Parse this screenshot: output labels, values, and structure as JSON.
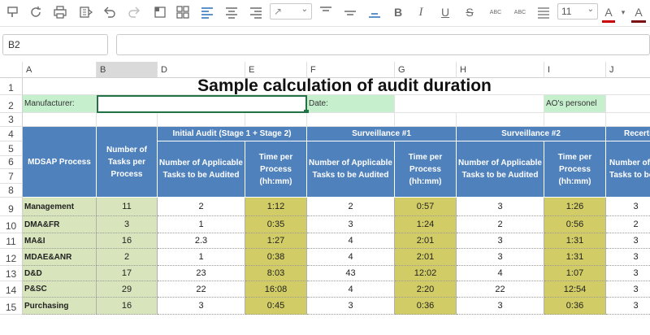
{
  "toolbar": {
    "font_size": "11",
    "font_size_arrow": "⌄",
    "rotate_arrow": "⌄",
    "bold": "B",
    "italic": "I",
    "underline": "U",
    "strike": "S",
    "abc1": "ABC",
    "abc2": "ABC",
    "font_color_letter": "A",
    "highlight_letter": "A",
    "color_arrow": "▾",
    "text_color": "#cc0000"
  },
  "name_box": "B2",
  "columns": [
    "A",
    "B",
    "D",
    "E",
    "F",
    "G",
    "H",
    "I",
    "J"
  ],
  "selected_column": "B",
  "rows": [
    "1",
    "2",
    "3",
    "4",
    "5",
    "6",
    "7",
    "8",
    "9",
    "10",
    "11",
    "12",
    "13",
    "14",
    "15"
  ],
  "sheet": {
    "title": "Sample calculation of audit duration",
    "manufacturer_label": "Manufacturer:",
    "date_label": "Date:",
    "ao_label": "AO's personel",
    "headers": {
      "process": "MDSAP Process",
      "tasks_per_process": "Number of Tasks per Process",
      "initial_audit": "Initial Audit (Stage 1 + Stage 2)",
      "surveillance1": "Surveillance #1",
      "surveillance2": "Surveillance #2",
      "recertification": "Recerti",
      "applicable": "Number of Applicable Tasks to be Audited",
      "time": "Time per Process (hh:mm)",
      "applicable_cut": "Number of A Tasks to be"
    },
    "data_rows": [
      {
        "process": "Management",
        "tasks": "11",
        "ia_n": "2",
        "ia_t": "1:12",
        "s1_n": "2",
        "s1_t": "0:57",
        "s2_n": "3",
        "s2_t": "1:26",
        "rc_n": "3"
      },
      {
        "process": "DMA&FR",
        "tasks": "3",
        "ia_n": "1",
        "ia_t": "0:35",
        "s1_n": "3",
        "s1_t": "1:24",
        "s2_n": "2",
        "s2_t": "0:56",
        "rc_n": "2"
      },
      {
        "process": "MA&I",
        "tasks": "16",
        "ia_n": "2.3",
        "ia_t": "1:27",
        "s1_n": "4",
        "s1_t": "2:01",
        "s2_n": "3",
        "s2_t": "1:31",
        "rc_n": "3"
      },
      {
        "process": "MDAE&ANR",
        "tasks": "2",
        "ia_n": "1",
        "ia_t": "0:38",
        "s1_n": "4",
        "s1_t": "2:01",
        "s2_n": "3",
        "s2_t": "1:31",
        "rc_n": "3"
      },
      {
        "process": "D&D",
        "tasks": "17",
        "ia_n": "23",
        "ia_t": "8:03",
        "s1_n": "43",
        "s1_t": "12:02",
        "s2_n": "4",
        "s2_t": "1:07",
        "rc_n": "3"
      },
      {
        "process": "P&SC",
        "tasks": "29",
        "ia_n": "22",
        "ia_t": "16:08",
        "s1_n": "4",
        "s1_t": "2:20",
        "s2_n": "22",
        "s2_t": "12:54",
        "rc_n": "3"
      },
      {
        "process": "Purchasing",
        "tasks": "16",
        "ia_n": "3",
        "ia_t": "0:45",
        "s1_n": "3",
        "s1_t": "0:36",
        "s2_n": "3",
        "s2_t": "0:36",
        "rc_n": "3"
      }
    ]
  },
  "colors": {
    "header_blue": "#4f81bd",
    "label_green": "#c6efce",
    "process_green": "#d8e4bc",
    "time_olive": "#d1cc65",
    "selection": "#217346"
  }
}
